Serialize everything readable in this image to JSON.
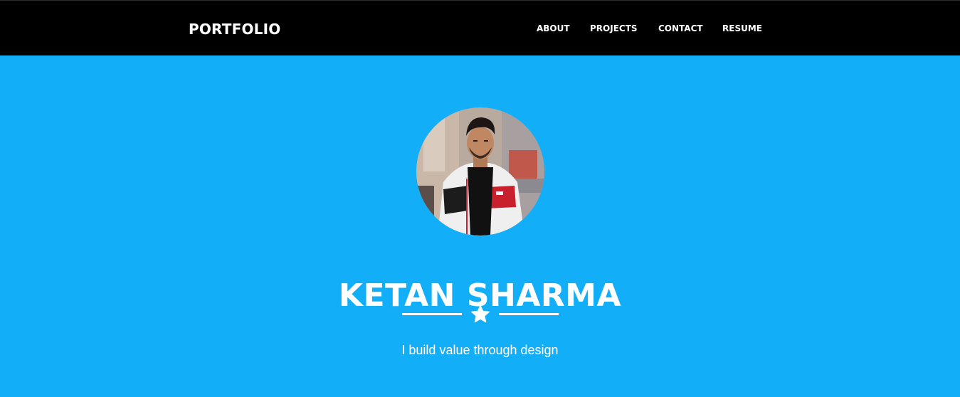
{
  "header": {
    "brand": "PORTFOLIO",
    "nav": [
      {
        "label": "ABOUT"
      },
      {
        "label": "PROJECTS"
      },
      {
        "label": "CONTACT"
      },
      {
        "label": "RESUME"
      }
    ]
  },
  "hero": {
    "avatar_icon": "profile-photo",
    "name": "KETAN SHARMA",
    "divider_icon": "star-icon",
    "tagline": "I build value through design"
  },
  "colors": {
    "header_bg": "#000000",
    "hero_bg": "#12aef7",
    "text": "#ffffff"
  }
}
